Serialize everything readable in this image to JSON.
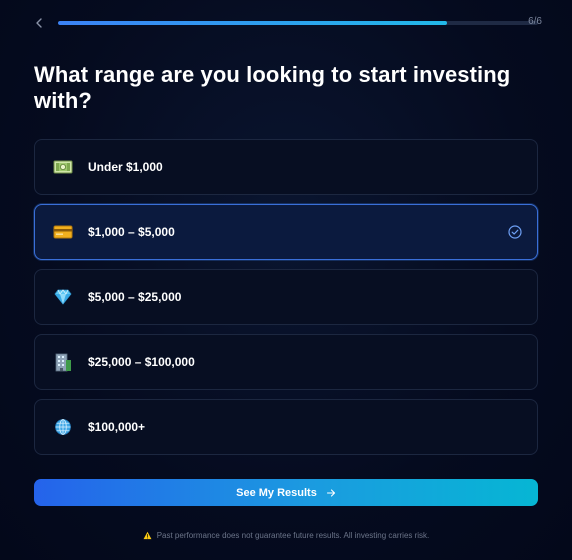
{
  "header": {
    "progress_fraction": 0.81,
    "step_label": "6/6"
  },
  "question": "What range are you looking to start investing with?",
  "options": [
    {
      "label": "Under $1,000",
      "icon": "money-bills-icon",
      "selected": false
    },
    {
      "label": "$1,000 – $5,000",
      "icon": "credit-card-icon",
      "selected": true
    },
    {
      "label": "$5,000 – $25,000",
      "icon": "diamond-icon",
      "selected": false
    },
    {
      "label": "$25,000 – $100,000",
      "icon": "office-building-icon",
      "selected": false
    },
    {
      "label": "$100,000+",
      "icon": "globe-icon",
      "selected": false
    }
  ],
  "cta": {
    "label": "See My Results"
  },
  "disclaimer": "Past performance does not guarantee future results. All investing carries risk.",
  "colors": {
    "background": "#050b1f",
    "accent_start": "#2563eb",
    "accent_end": "#06b6d4",
    "selected_border": "#3a6fd8",
    "warning": "#facc15"
  }
}
